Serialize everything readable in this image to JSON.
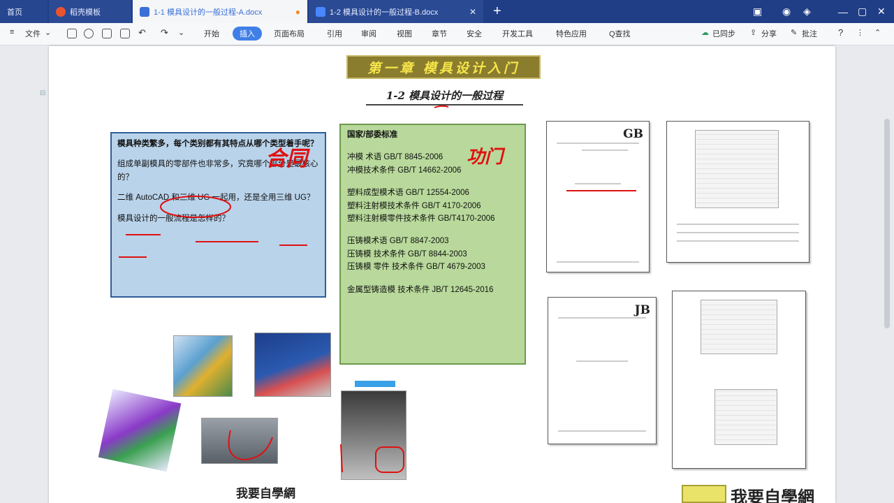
{
  "tabs": {
    "home": "首页",
    "templates": "稻壳模板",
    "active_doc": "1-1 模具设计的一般过程-A.docx",
    "doc_b": "1-2 模具设计的一般过程-B.docx",
    "plus": "+"
  },
  "ribbon": {
    "file_menu": "文件",
    "items": [
      "开始",
      "插入",
      "页面布局",
      "引用",
      "审阅",
      "视图",
      "章节",
      "安全",
      "开发工具",
      "特色应用"
    ],
    "search": "Q查找",
    "synced": "已同步",
    "share": "分享",
    "annotate": "批注",
    "help": "?"
  },
  "document": {
    "chapter_title": "第一章 模具设计入门",
    "section_title": "1-2 模具设计的一般过程",
    "blue_box": {
      "q1": "模具种类繁多，每个类别都有其特点从哪个类型着手呢？",
      "q2": "组成单副模具的零部件也非常多，究竟哪个部分是最核心的？",
      "q3": "二维 AutoCAD 和三维 UG 一起用，还是全用三维 UG？",
      "q4": "模具设计的一般流程是怎样的？"
    },
    "green_box": {
      "heading": "国家/部委标准",
      "group1": [
        "冲模  术语  GB/T 8845-2006",
        "冲模技术条件  GB/T 14662-2006"
      ],
      "group2": [
        "塑料成型模术语  GB/T 12554-2006",
        "塑料注射模技术条件  GB/T 4170-2006",
        "塑料注射模零件技术条件 GB/T4170-2006"
      ],
      "group3": [
        "压铸模术语  GB/T 8847-2003",
        "压铸模  技术条件  GB/T 8844-2003",
        "压铸模  零件  技术条件  GB/T 4679-2003"
      ],
      "group4": [
        "金属型铸造模  技术条件  JB/T 12645-2016"
      ]
    },
    "annotations": {
      "a1": "合同",
      "a2": "功门"
    },
    "gb_badge": "GB",
    "jb_badge": "JB",
    "footer_logo": "我要自學網",
    "bottom_logo": "我要自學網"
  },
  "colors": {
    "tabbar": "#1f3e86",
    "active_tab": "#f5f6f8",
    "ribbon_active": "#3f7fe8",
    "blue_box": "#b9d3ea",
    "green_box": "#b8d99b",
    "title_bg": "#8a7d2e",
    "annotation": "#e01010"
  }
}
